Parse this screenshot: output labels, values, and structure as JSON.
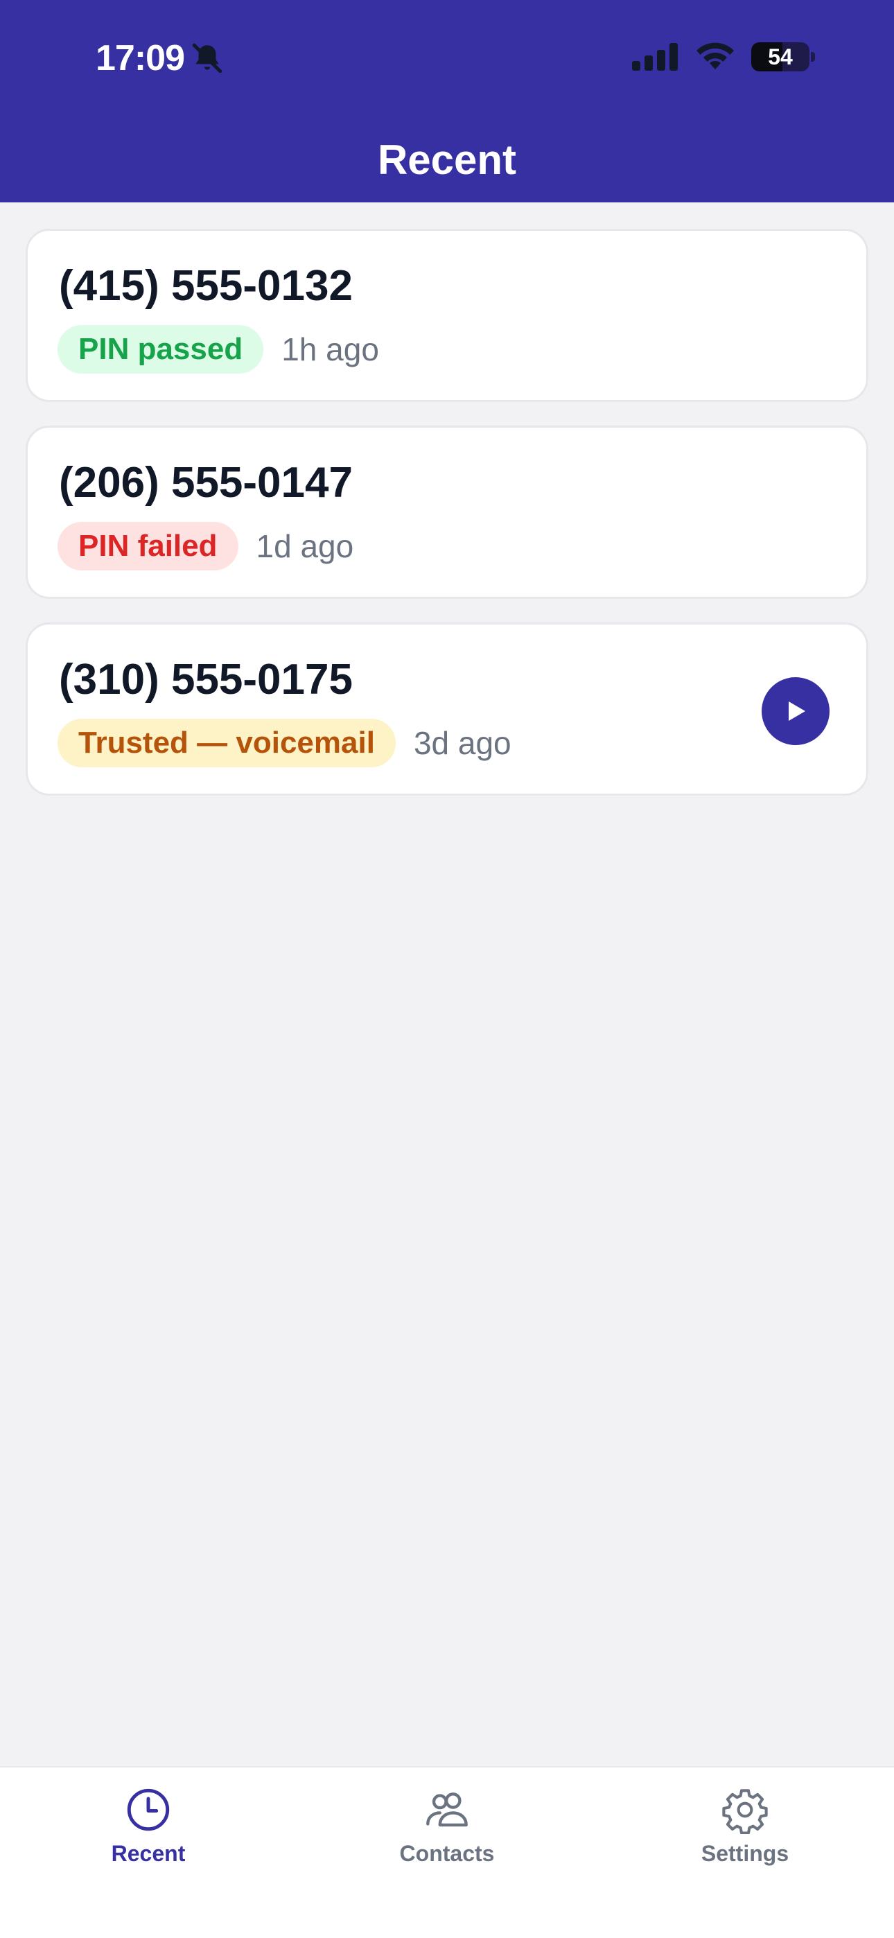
{
  "status_bar": {
    "time": "17:09",
    "battery_level": "54"
  },
  "header": {
    "title": "Recent"
  },
  "calls": [
    {
      "number": "(415) 555-0132",
      "badge": "PIN passed",
      "badge_tone": "green",
      "ago": "1h ago"
    },
    {
      "number": "(206) 555-0147",
      "badge": "PIN failed",
      "badge_tone": "red",
      "ago": "1d ago"
    },
    {
      "number": "(310) 555-0175",
      "badge": "Trusted — voicemail",
      "badge_tone": "amber",
      "ago": "3d ago",
      "has_voicemail": true
    }
  ],
  "tabs": [
    {
      "label": "Recent",
      "icon": "clock-icon",
      "active": true
    },
    {
      "label": "Contacts",
      "icon": "contacts-icon",
      "active": false
    },
    {
      "label": "Settings",
      "icon": "gear-icon",
      "active": false
    }
  ],
  "colors": {
    "primary": "#3730a3",
    "background": "#f2f2f5",
    "pin_passed_bg": "#dcfce7",
    "pin_passed_text": "#16a34a",
    "pin_failed_bg": "#fee2e2",
    "pin_failed_text": "#dc2626",
    "trusted_bg": "#fef3c7",
    "trusted_text": "#b45309"
  }
}
